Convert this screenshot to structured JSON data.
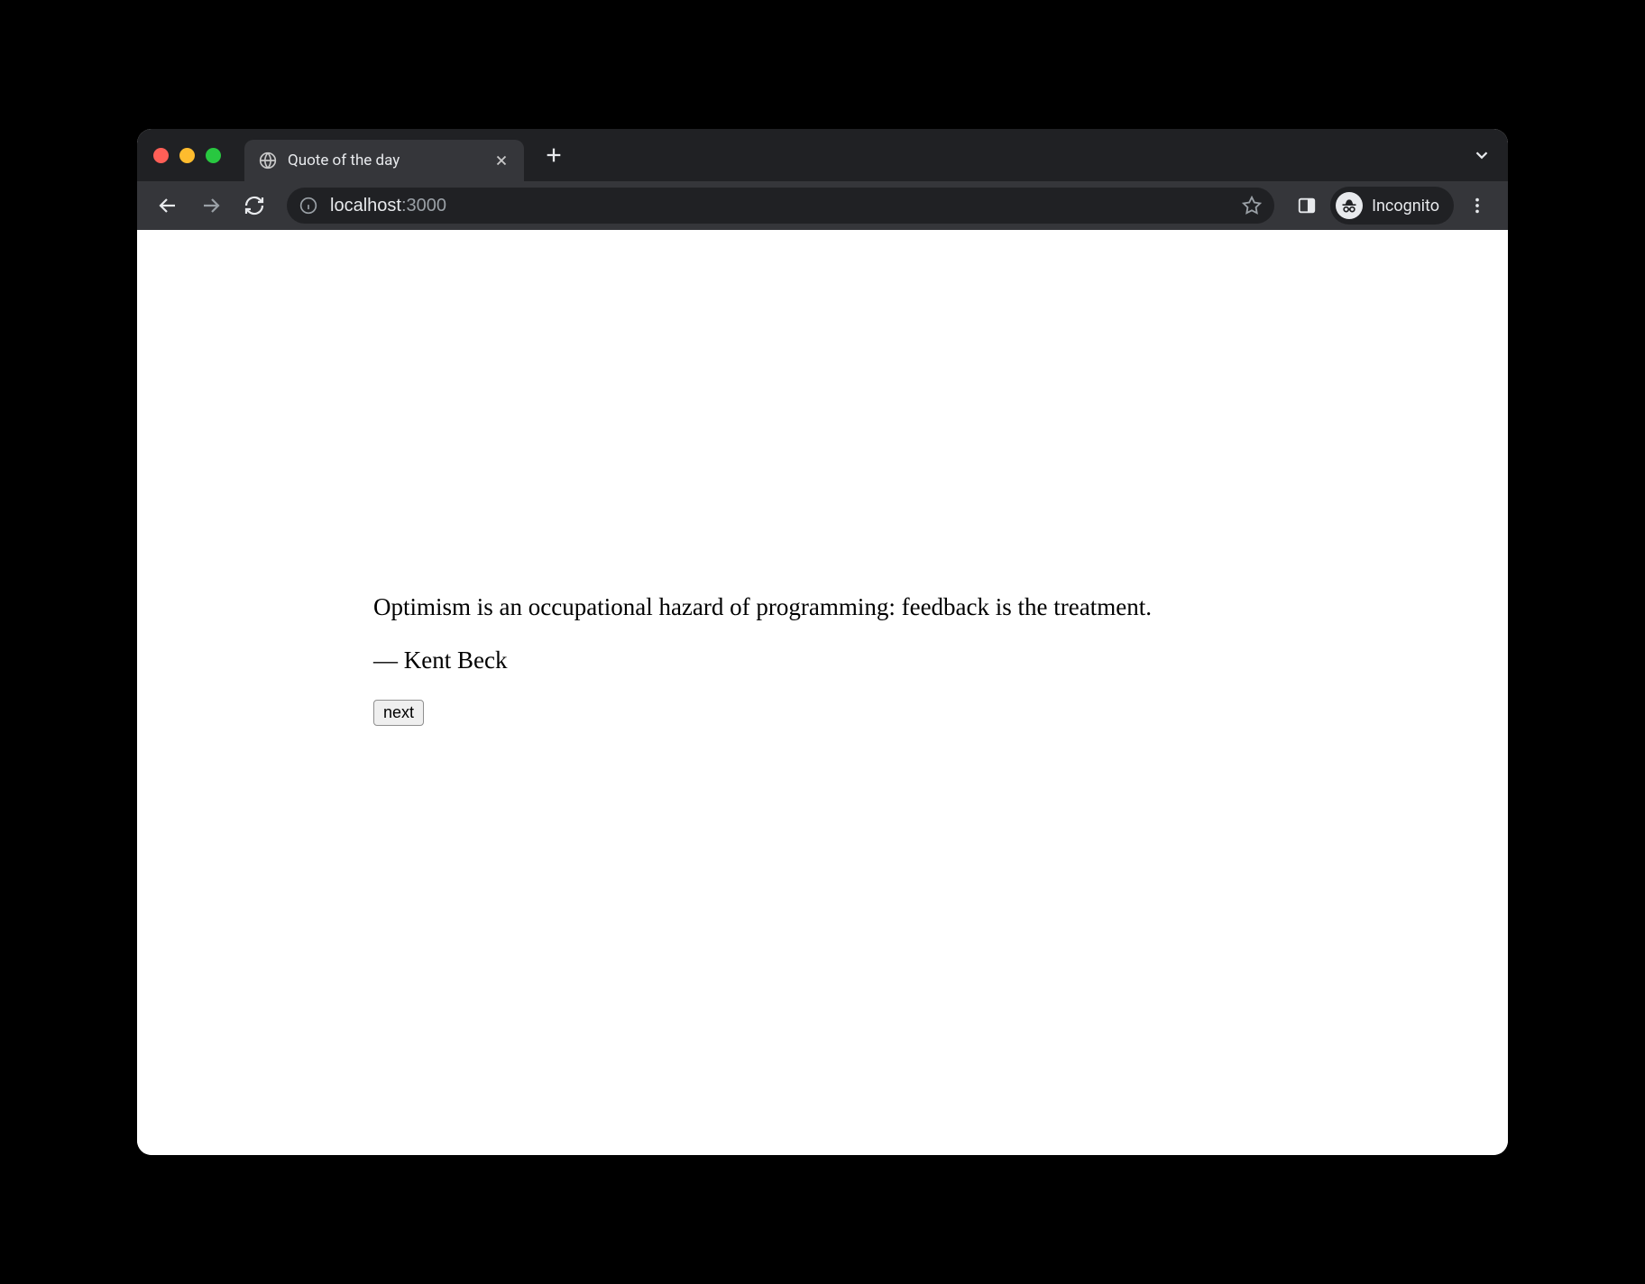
{
  "browser": {
    "tab_title": "Quote of the day",
    "new_tab_label": "New tab",
    "close_tab_label": "Close tab"
  },
  "address_bar": {
    "host": "localhost",
    "port": ":3000"
  },
  "toolbar": {
    "incognito_label": "Incognito"
  },
  "page": {
    "quote": "Optimism is an occupational hazard of programming: feedback is the treatment.",
    "author_prefix": "— ",
    "author": "Kent Beck",
    "next_button_label": "next"
  }
}
